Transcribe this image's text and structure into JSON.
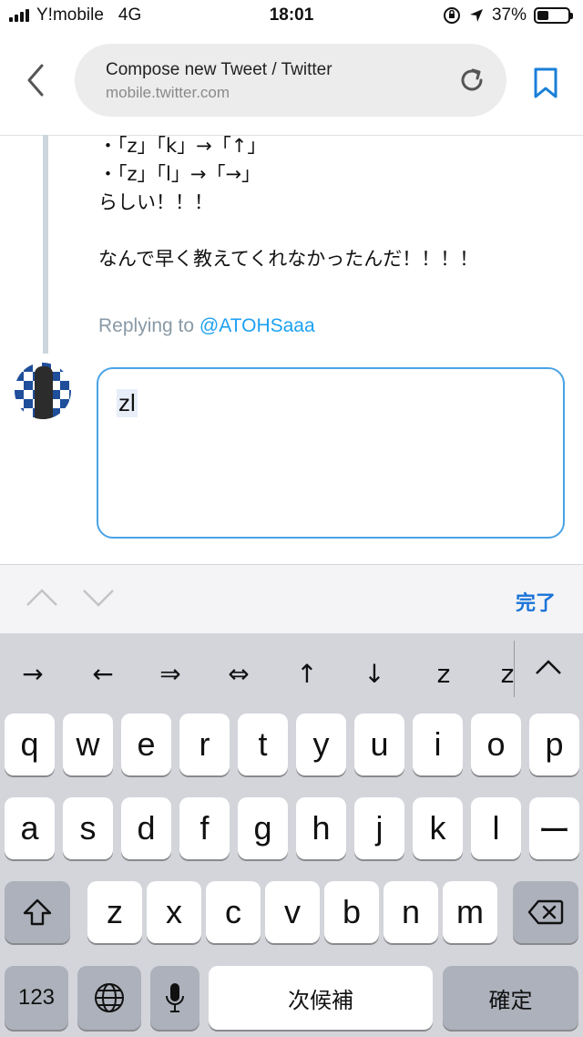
{
  "status_bar": {
    "carrier": "Y!mobile",
    "network": "4G",
    "time": "18:01",
    "battery": "37%",
    "battery_level": 0.37
  },
  "browser": {
    "page_title": "Compose new Tweet / Twitter",
    "domain": "mobile.twitter.com"
  },
  "tweet": {
    "text": "・「z」「k」→「↑」\n・「z」「l」→「→」\nらしい！！！\n\nなんで早く教えてくれなかったんだ！！！！",
    "replying_prefix": "Replying to ",
    "replying_handle": "@ATOHSaaa"
  },
  "compose": {
    "value": "zl"
  },
  "accessory": {
    "done_label": "完了"
  },
  "keyboard": {
    "candidates": [
      "→",
      "←",
      "⇒",
      "⇔",
      "↑",
      "↓",
      "z",
      "z"
    ],
    "row1": [
      "q",
      "w",
      "e",
      "r",
      "t",
      "y",
      "u",
      "i",
      "o",
      "p"
    ],
    "row2": [
      "a",
      "s",
      "d",
      "f",
      "g",
      "h",
      "j",
      "k",
      "l",
      "ー"
    ],
    "row3": [
      "z",
      "x",
      "c",
      "v",
      "b",
      "n",
      "m"
    ],
    "numbers_label": "123",
    "space_label": "次候補",
    "return_label": "確定"
  }
}
